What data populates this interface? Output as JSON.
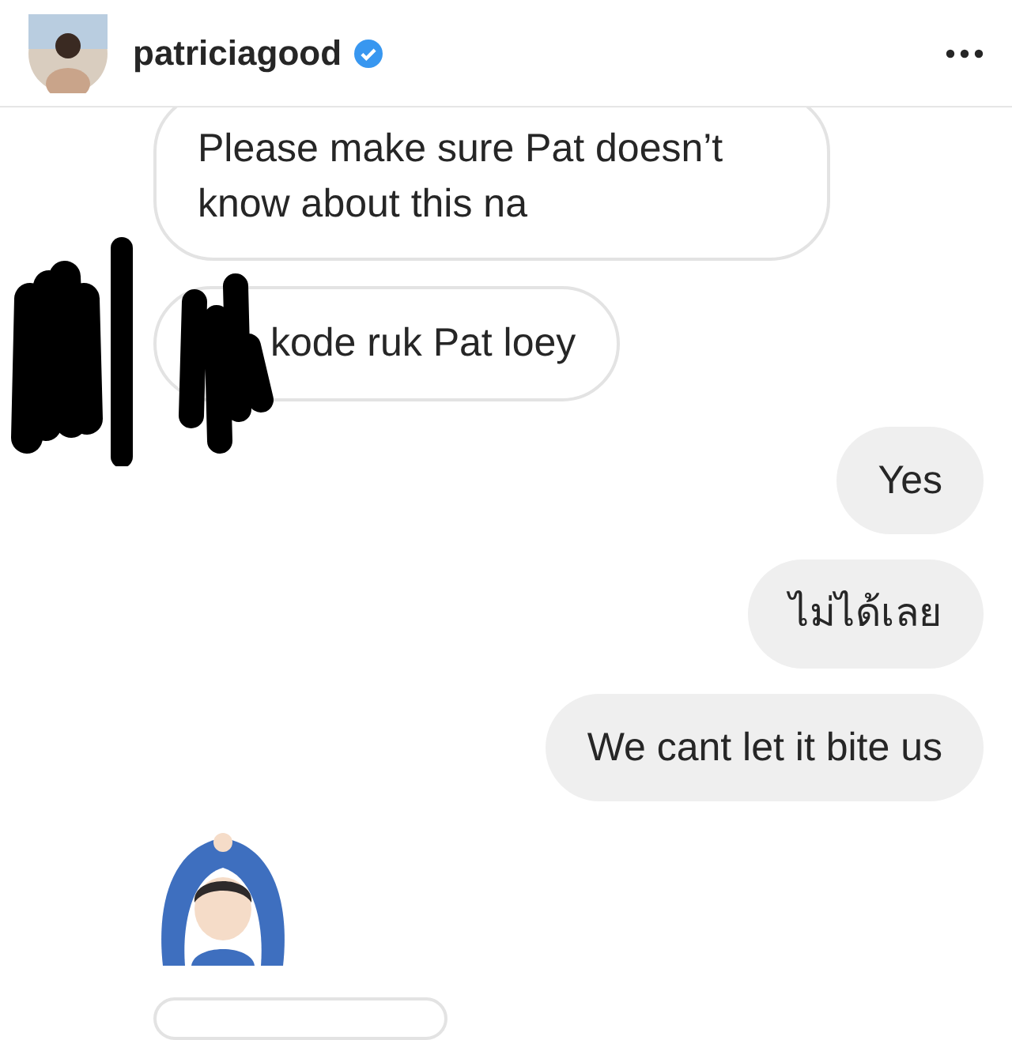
{
  "header": {
    "username": "patriciagood",
    "verified": true
  },
  "messages": [
    {
      "kind": "received",
      "text": "Please make sure Pat doesn’t know about this na"
    },
    {
      "kind": "received",
      "text": "kode ruk Pat loey",
      "redacted": true
    },
    {
      "kind": "sent",
      "text": "Yes"
    },
    {
      "kind": "sent",
      "text": "ไม่ได้เลย"
    },
    {
      "kind": "sent",
      "text": "We cant let it bite us"
    },
    {
      "kind": "emoji"
    },
    {
      "kind": "received-cut"
    }
  ]
}
